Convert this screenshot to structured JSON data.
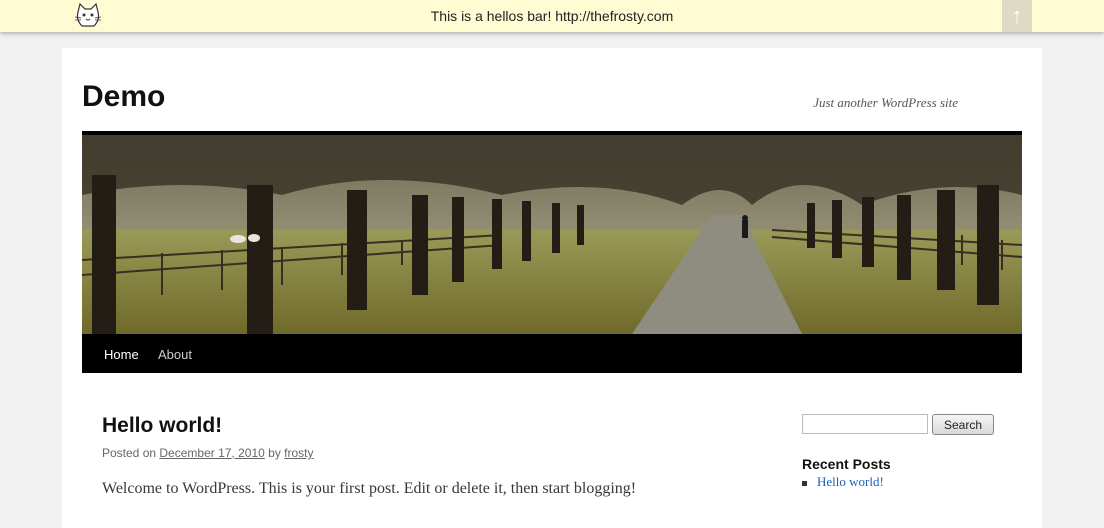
{
  "hellobar": {
    "message": "This is a hellos bar!",
    "link": "http://thefrosty.com",
    "toggle_icon": "↑"
  },
  "site": {
    "title": "Demo",
    "description": "Just another WordPress site"
  },
  "nav": {
    "items": [
      {
        "label": "Home",
        "current": true
      },
      {
        "label": "About",
        "current": false
      }
    ]
  },
  "post": {
    "title": "Hello world!",
    "meta_prefix": "Posted on",
    "date": "December 17, 2010",
    "meta_by": "by",
    "author": "frosty",
    "content": "Welcome to WordPress. This is your first post. Edit or delete it, then start blogging!"
  },
  "sidebar": {
    "search_placeholder": "",
    "search_button": "Search",
    "recent_title": "Recent Posts",
    "recent_posts": [
      "Hello world!"
    ]
  },
  "colors": {
    "hellobar_bg": "#fffcd4",
    "nav_bg": "#000000",
    "link": "#1b60b8"
  }
}
